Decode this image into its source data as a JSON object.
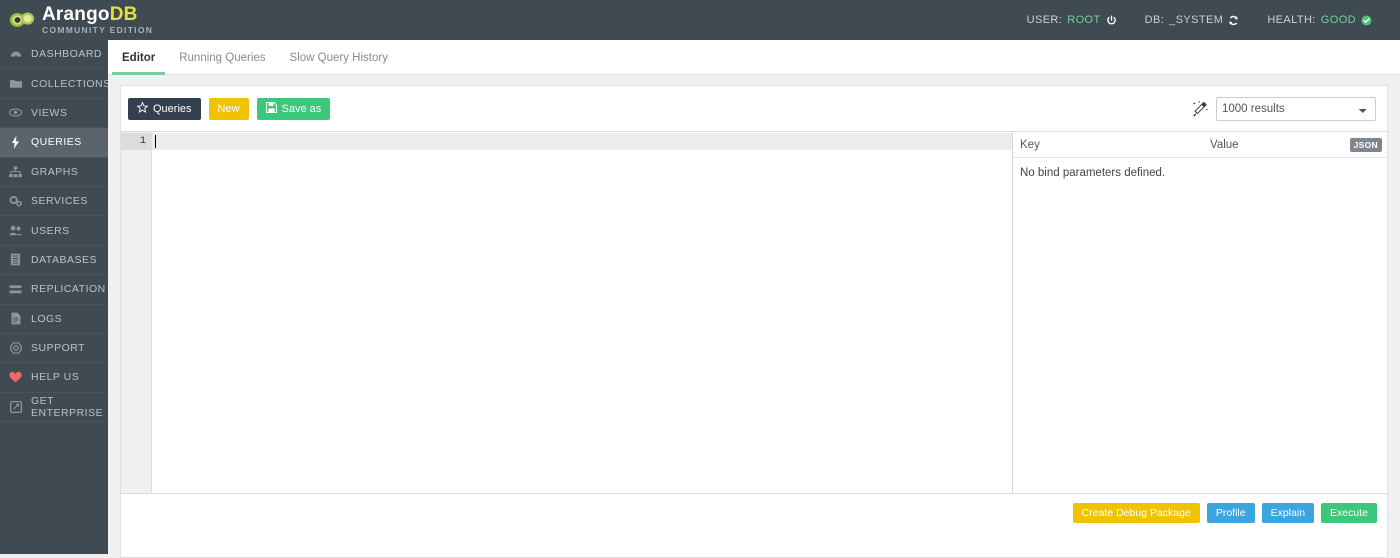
{
  "header": {
    "brand_name_1": "Arango",
    "brand_name_2": "DB",
    "brand_subtitle": "COMMUNITY EDITION",
    "status": [
      {
        "label": "USER:",
        "value": "ROOT",
        "icon": "power-icon"
      },
      {
        "label": "DB:",
        "value": "_SYSTEM",
        "icon": "refresh-icon"
      },
      {
        "label": "HEALTH:",
        "value": "GOOD",
        "icon": "check-circle-icon"
      }
    ]
  },
  "sidebar": {
    "items": [
      {
        "label": "DASHBOARD",
        "icon": "dashboard-icon",
        "active": false
      },
      {
        "label": "COLLECTIONS",
        "icon": "folder-icon",
        "active": false
      },
      {
        "label": "VIEWS",
        "icon": "eye-icon",
        "active": false
      },
      {
        "label": "QUERIES",
        "icon": "bolt-icon",
        "active": true
      },
      {
        "label": "GRAPHS",
        "icon": "sitemap-icon",
        "active": false
      },
      {
        "label": "SERVICES",
        "icon": "cogs-icon",
        "active": false
      },
      {
        "label": "USERS",
        "icon": "users-icon",
        "active": false
      },
      {
        "label": "DATABASES",
        "icon": "database-icon",
        "active": false
      },
      {
        "label": "REPLICATION",
        "icon": "replication-icon",
        "active": false
      },
      {
        "label": "LOGS",
        "icon": "file-icon",
        "active": false
      },
      {
        "label": "SUPPORT",
        "icon": "life-ring-icon",
        "active": false
      },
      {
        "label": "HELP US",
        "icon": "heart-icon",
        "active": false
      },
      {
        "label": "GET ENTERPRISE",
        "icon": "enterprise-icon",
        "active": false
      }
    ]
  },
  "tabs": [
    {
      "label": "Editor",
      "active": true
    },
    {
      "label": "Running Queries",
      "active": false
    },
    {
      "label": "Slow Query History",
      "active": false
    }
  ],
  "toolbar": {
    "queries_label": "Queries",
    "new_label": "New",
    "save_as_label": "Save as",
    "wand_icon": "magic-wand-icon",
    "results_selected": "1000 results",
    "results_options": [
      "1000 results"
    ]
  },
  "editor": {
    "line_numbers": [
      "1"
    ],
    "content": ""
  },
  "bind_parameters": {
    "col_key": "Key",
    "col_value": "Value",
    "json_toggle": "JSON",
    "empty_message": "No bind parameters defined."
  },
  "footer_actions": [
    {
      "label": "Create Debug Package",
      "style": "yellow"
    },
    {
      "label": "Profile",
      "style": "blue"
    },
    {
      "label": "Explain",
      "style": "blue"
    },
    {
      "label": "Execute",
      "style": "green"
    }
  ],
  "colors": {
    "chrome": "#404a53",
    "accent_green": "#3dc77b",
    "accent_yellow": "#f0c300",
    "accent_blue": "#3ba5e0",
    "tab_underline": "#77cf9b",
    "brand_yellow": "#e2e23c"
  }
}
